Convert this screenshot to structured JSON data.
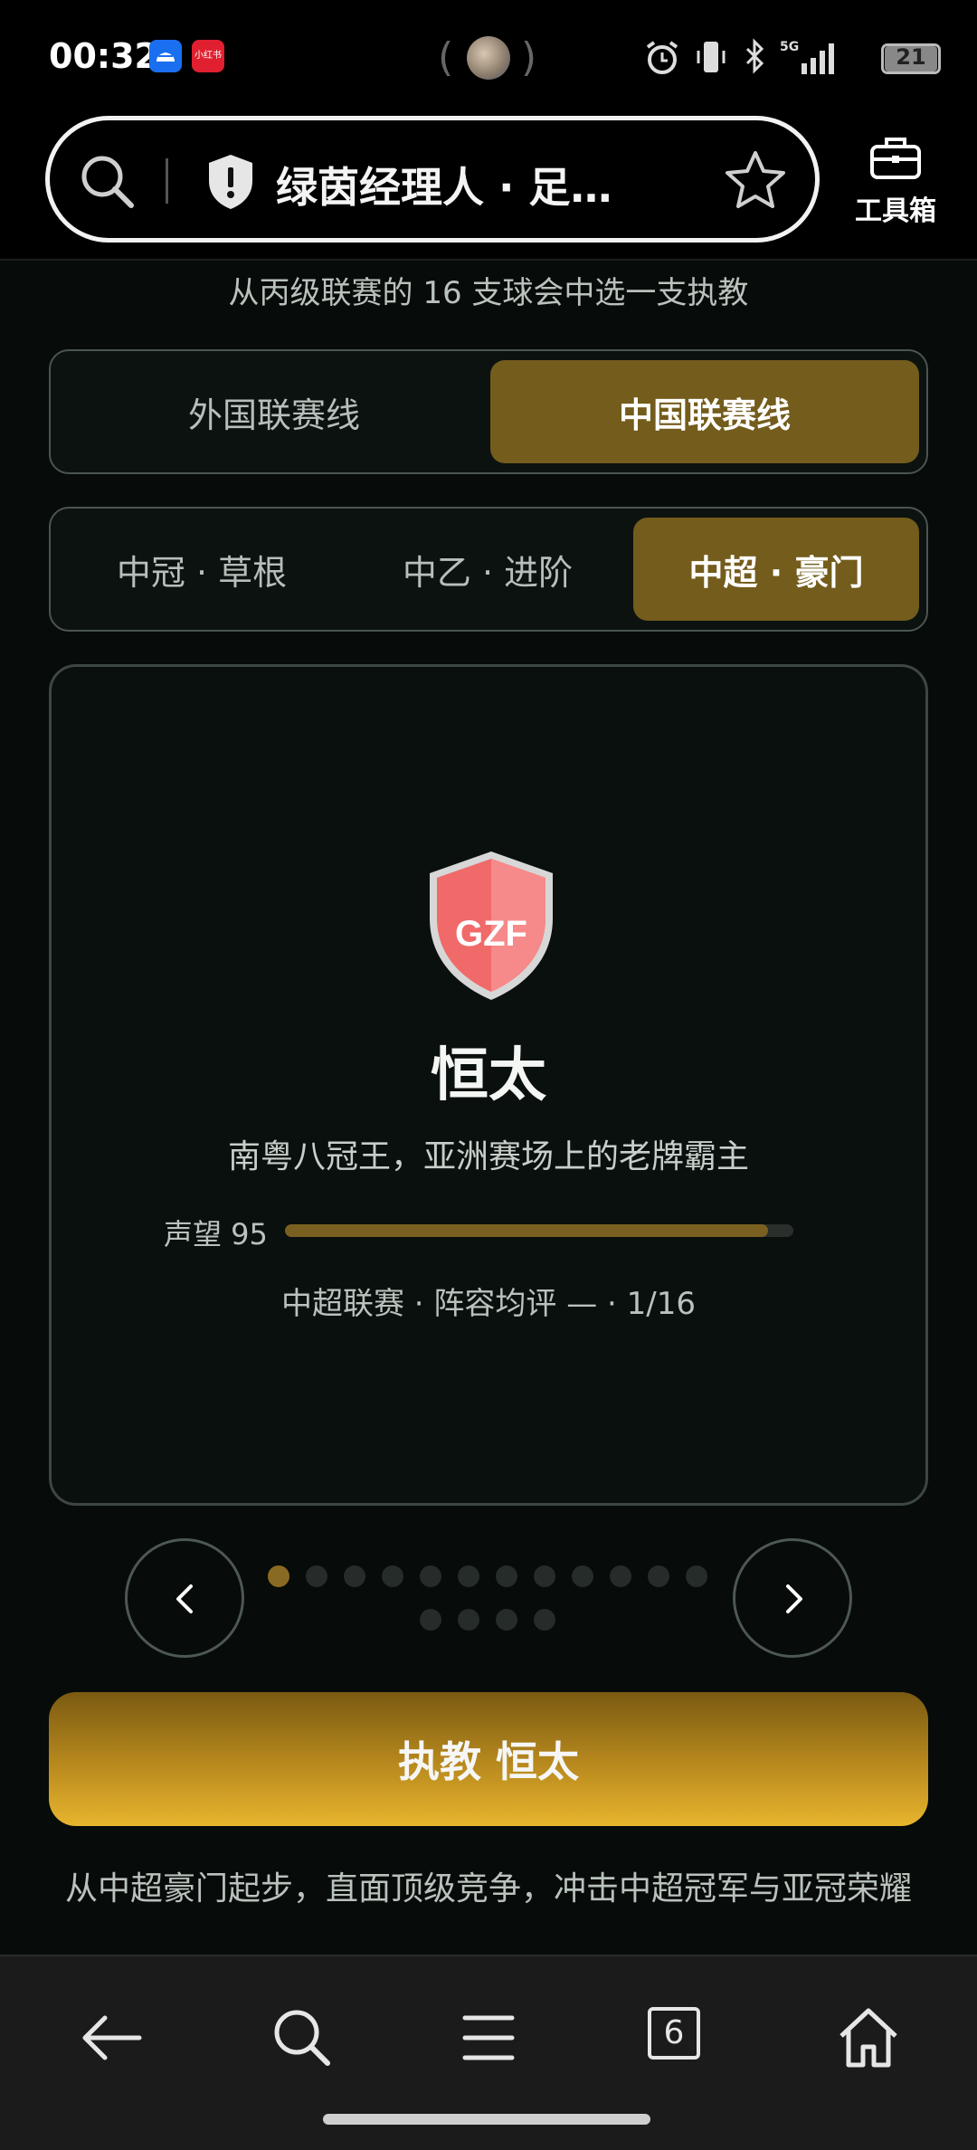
{
  "status_bar": {
    "time": "00:32",
    "apps": [
      "cloud-app-icon",
      "xiaohongshu-app-icon"
    ],
    "app_b_text": "小红书",
    "battery": "21",
    "network": "5G"
  },
  "address_bar": {
    "title": "绿茵经理人 · 足…",
    "toolbox_label": "工具箱"
  },
  "subtitle": "从丙级联赛的 16 支球会中选一支执教",
  "league_line_tabs": [
    {
      "label": "外国联赛线",
      "active": false
    },
    {
      "label": "中国联赛线",
      "active": true
    }
  ],
  "tier_tabs": [
    {
      "label": "中冠 · 草根",
      "active": false
    },
    {
      "label": "中乙 · 进阶",
      "active": false
    },
    {
      "label": "中超 · 豪门",
      "active": true
    }
  ],
  "club": {
    "crest_text": "GZF",
    "crest_color": "#f06a6a",
    "name": "恒太",
    "description": "南粤八冠王，亚洲赛场上的老牌霸主",
    "reputation_label": "声望 95",
    "reputation_value": 95,
    "meta": "中超联赛 · 阵容均评 — · 1/16"
  },
  "pagination": {
    "total": 16,
    "current": 1
  },
  "cta_label": "执教 恒太",
  "footnote": "从中超豪门起步，直面顶级竞争，冲击中超冠军与亚冠荣耀",
  "bottom_nav": {
    "tabs_count": "6",
    "items": [
      "back-icon",
      "search-icon",
      "menu-icon",
      "tabs-icon",
      "home-icon"
    ]
  },
  "colors": {
    "accent": "#735c1c",
    "cta_gradient_end": "#e8b52e",
    "background": "#070b09"
  }
}
